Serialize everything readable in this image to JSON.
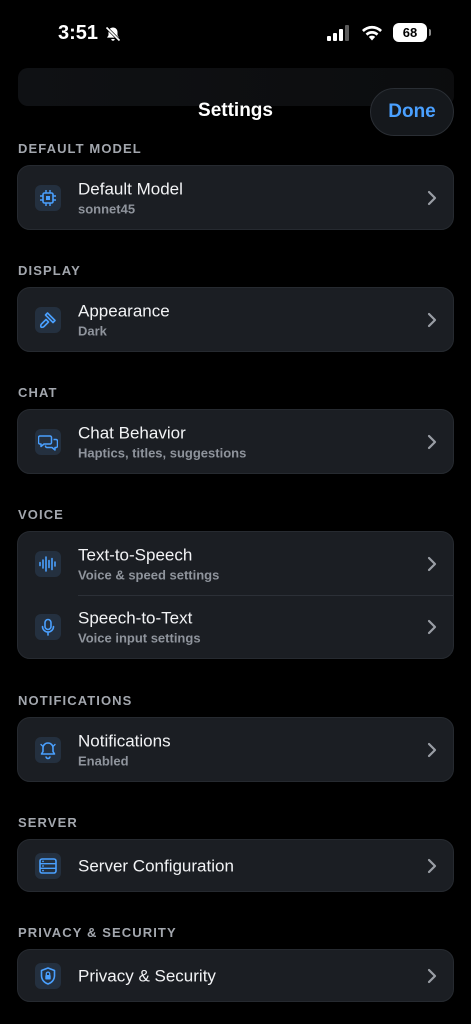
{
  "status": {
    "time": "3:51",
    "battery": "68"
  },
  "header": {
    "title": "Settings",
    "done_label": "Done"
  },
  "sections": {
    "default_model": {
      "label": "DEFAULT MODEL",
      "title": "Default Model",
      "subtitle": "sonnet45"
    },
    "display": {
      "label": "DISPLAY",
      "title": "Appearance",
      "subtitle": "Dark"
    },
    "chat": {
      "label": "CHAT",
      "title": "Chat Behavior",
      "subtitle": "Haptics, titles, suggestions"
    },
    "voice": {
      "label": "VOICE",
      "tts_title": "Text-to-Speech",
      "tts_subtitle": "Voice & speed settings",
      "stt_title": "Speech-to-Text",
      "stt_subtitle": "Voice input settings"
    },
    "notifications": {
      "label": "NOTIFICATIONS",
      "title": "Notifications",
      "subtitle": "Enabled"
    },
    "server": {
      "label": "SERVER",
      "title": "Server Configuration"
    },
    "privacy": {
      "label": "PRIVACY & SECURITY",
      "title": "Privacy & Security"
    }
  },
  "colors": {
    "accent": "#4aa0ff",
    "card": "#1b1e23",
    "icon_bg": "#24303f"
  },
  "icons": {
    "default_model": "chip-icon",
    "display": "paintbrush-icon",
    "chat": "chat-bubbles-icon",
    "tts": "waveform-icon",
    "stt": "microphone-icon",
    "notifications": "bell-icon",
    "server": "server-icon",
    "privacy": "lock-shield-icon"
  }
}
